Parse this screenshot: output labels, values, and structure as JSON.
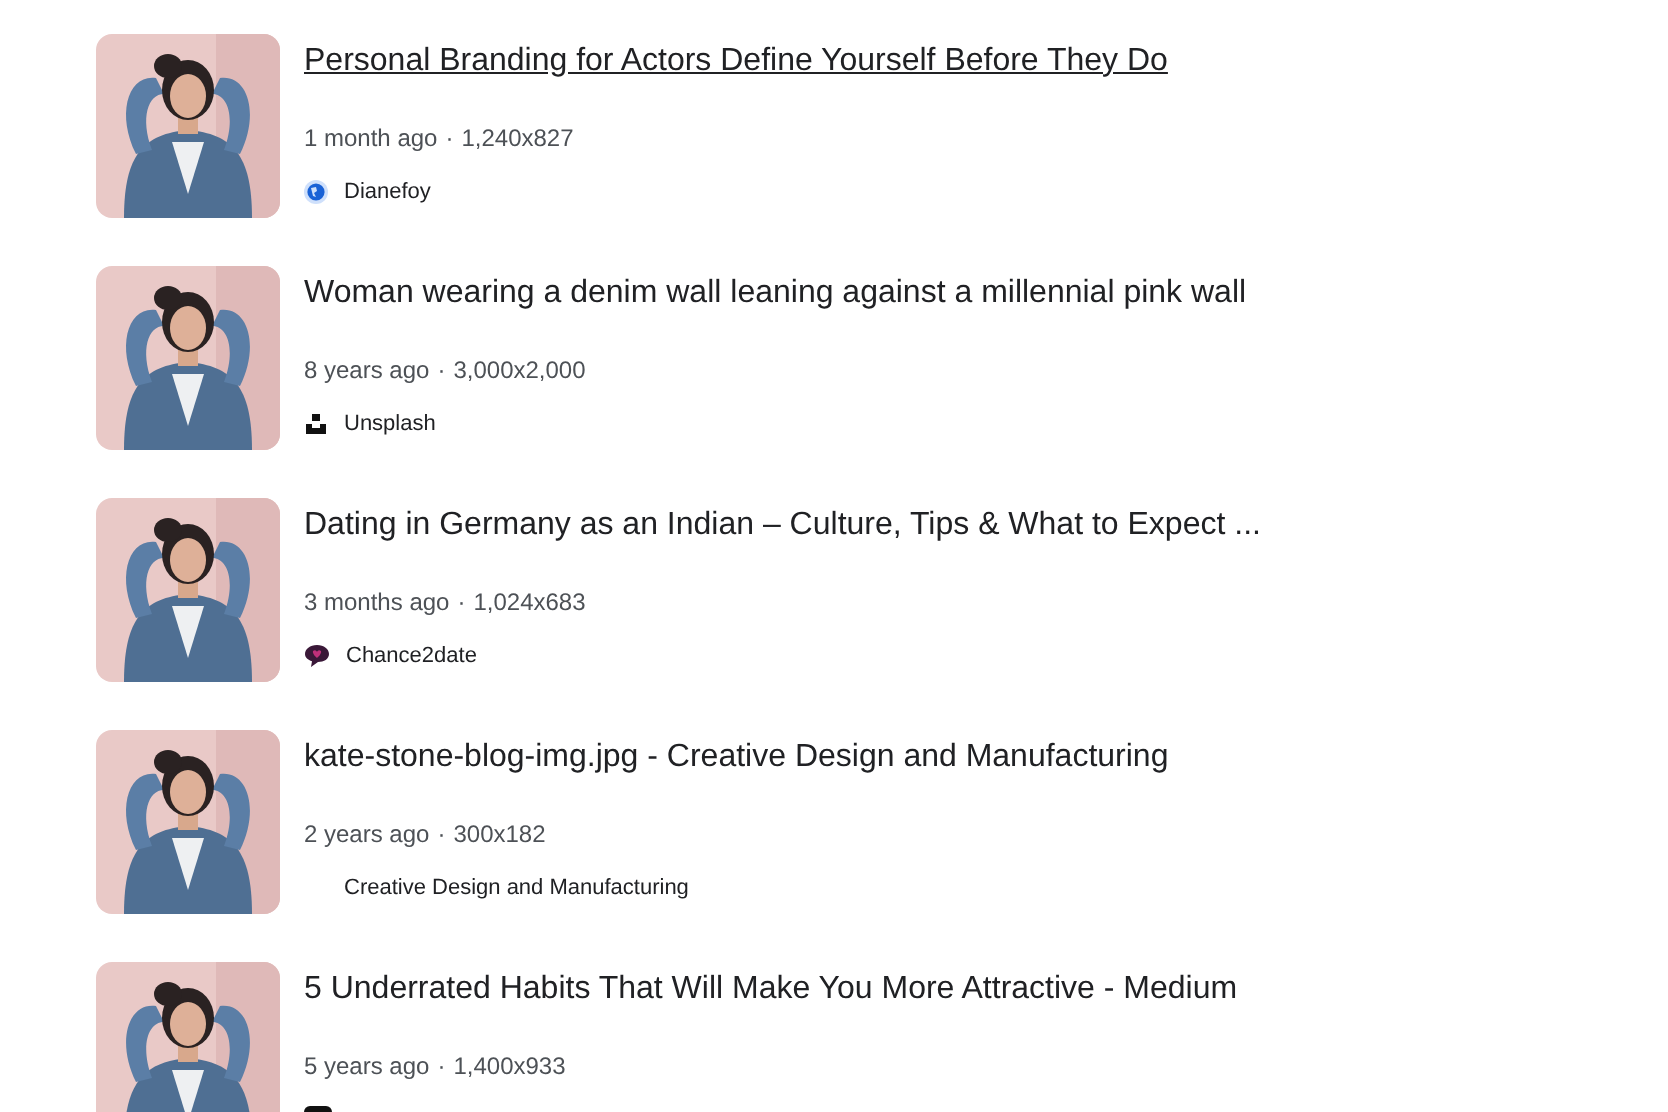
{
  "results": [
    {
      "title": "Personal Branding for Actors Define Yourself Before They Do",
      "underlined": true,
      "age": "1 month ago",
      "separator": "·",
      "size": "1,240x827",
      "source": {
        "kind": "globe",
        "name": "Dianefoy"
      }
    },
    {
      "title": "Woman wearing a denim wall leaning against a millennial pink wall",
      "underlined": false,
      "age": "8 years ago",
      "separator": "·",
      "size": "3,000x2,000",
      "source": {
        "kind": "camera",
        "name": "Unsplash"
      }
    },
    {
      "title": "Dating in Germany as an Indian – Culture, Tips & What to Expect ...",
      "underlined": false,
      "age": "3 months ago",
      "separator": "·",
      "size": "1,024x683",
      "source": {
        "kind": "chat",
        "name": "Chance2date"
      }
    },
    {
      "title": "kate-stone-blog-img.jpg - Creative Design and Manufacturing",
      "underlined": false,
      "age": "2 years ago",
      "separator": "·",
      "size": "300x182",
      "source": {
        "name": "Creative Design and Manufacturing"
      }
    },
    {
      "title": "5 Underrated Habits That Will Make You More Attractive - Medium",
      "underlined": false,
      "age": "5 years ago",
      "separator": "·",
      "size": "1,400x933",
      "source": {
        "kind": "square"
      }
    }
  ]
}
